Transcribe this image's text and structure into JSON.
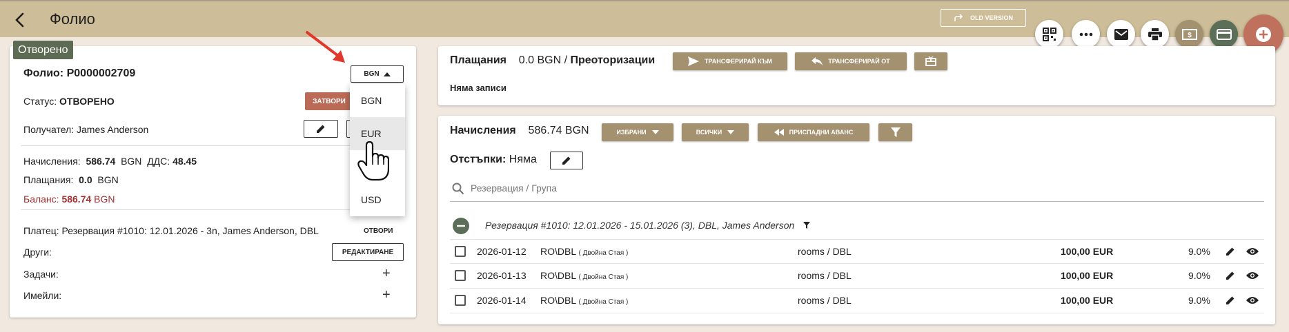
{
  "header": {
    "title": "Фолио",
    "old_version_label": "OLD VERSION"
  },
  "left_panel": {
    "status_badge": "Отворено",
    "folio_label": "Фолио:",
    "folio_number": "P0000002709",
    "currency_selected": "BGN",
    "status_label": "Статус:",
    "status_value": "ОТВОРЕНО",
    "close_button": "ЗАТВОРИ",
    "recipient": "Получател: James Anderson",
    "charges_label": "Начисления:",
    "charges_value": "586.74",
    "charges_currency": "BGN",
    "vat_label": "ДДС:",
    "vat_value": "48.45",
    "payments_label": "Плащания:",
    "payments_value": "0.0",
    "payments_currency": "BGN",
    "balance_label": "Баланс:",
    "balance_value": "586.74",
    "balance_currency": "BGN",
    "payer": "Платец: Резервация #1010: 12.01.2026 - 3n, James Anderson, DBL",
    "open_button": "ОТВОРИ",
    "others_label": "Други:",
    "edit_button": "РЕДАКТИРАНЕ",
    "tasks_label": "Задачи:",
    "emails_label": "Имейли:"
  },
  "currency_dropdown": {
    "options": [
      "BGN",
      "EUR",
      "USD"
    ],
    "hovered": "EUR"
  },
  "payments_card": {
    "title": "Плащания",
    "amount": "0.0 BGN",
    "separator": "/",
    "preauth_label": "Преоторизации",
    "transfer_to": "ТРАНСФЕРИРАЙ КЪМ",
    "transfer_from": "ТРАНСФЕРИРАЙ ОТ",
    "empty": "Няма записи"
  },
  "charges_card": {
    "title": "Начисления",
    "amount": "586.74 BGN",
    "selected_button": "ИЗБРАНИ",
    "all_button": "ВСИЧКИ",
    "deduct_button": "ПРИСПАДНИ АВАНС",
    "discounts_label": "Отстъпки:",
    "discounts_value": "Няма",
    "search_placeholder": "Резервация / Група",
    "group_label": "Резервация #1010: 12.01.2026 - 15.01.2026 (3), DBL, James Anderson",
    "rows": [
      {
        "date": "2026-01-12",
        "code": "RO\\DBL",
        "room_type": "( Двойна Стая )",
        "category": "rooms / DBL",
        "amount": "100,00 EUR",
        "vat": "9.0%"
      },
      {
        "date": "2026-01-13",
        "code": "RO\\DBL",
        "room_type": "( Двойна Стая )",
        "category": "rooms / DBL",
        "amount": "100,00 EUR",
        "vat": "9.0%"
      },
      {
        "date": "2026-01-14",
        "code": "RO\\DBL",
        "room_type": "( Двойна Стая )",
        "category": "rooms / DBL",
        "amount": "100,00 EUR",
        "vat": "9.0%"
      }
    ]
  },
  "colors": {
    "topbar": "#cdbd98",
    "accent_tan": "#a4916f",
    "accent_green": "#5b6e57",
    "accent_red": "#c0715e",
    "balance_red": "#a33030"
  }
}
